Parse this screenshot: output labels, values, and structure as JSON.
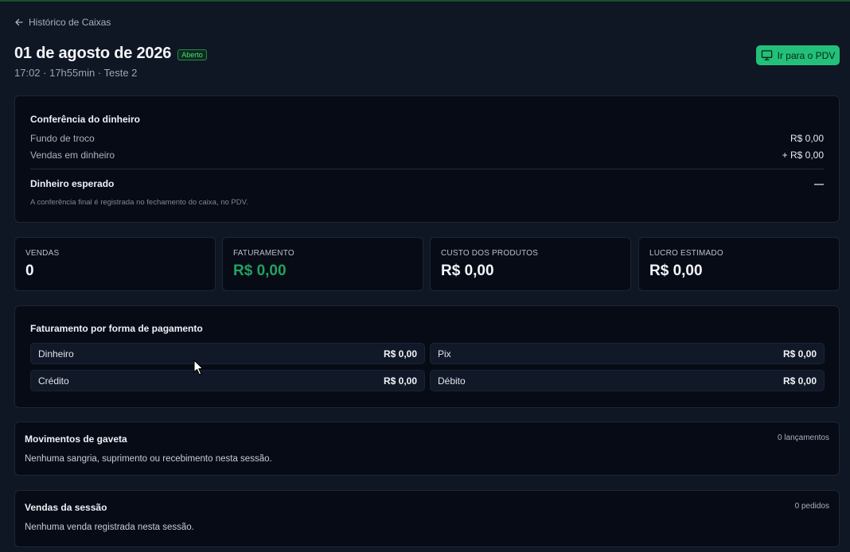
{
  "nav": {
    "back_label": "Histórico de Caixas"
  },
  "header": {
    "title": "01 de agosto de 2026",
    "status_badge": "Aberto",
    "subtitle": "17:02 · 17h55min · Teste 2",
    "pdv_button_label": "Ir para o PDV"
  },
  "conferencia": {
    "title": "Conferência do dinheiro",
    "rows": [
      {
        "label": "Fundo de troco",
        "value": "R$ 0,00"
      },
      {
        "label": "Vendas em dinheiro",
        "value": "+ R$ 0,00"
      }
    ],
    "expected_label": "Dinheiro esperado",
    "expected_value": "—",
    "note": "A conferência final é registrada no fechamento do caixa, no PDV."
  },
  "stats": [
    {
      "label": "VENDAS",
      "value": "0"
    },
    {
      "label": "FATURAMENTO",
      "value": "R$ 0,00"
    },
    {
      "label": "CUSTO DOS PRODUTOS",
      "value": "R$ 0,00"
    },
    {
      "label": "LUCRO ESTIMADO",
      "value": "R$ 0,00"
    }
  ],
  "payments": {
    "title": "Faturamento por forma de pagamento",
    "items": [
      {
        "label": "Dinheiro",
        "value": "R$ 0,00"
      },
      {
        "label": "Pix",
        "value": "R$ 0,00"
      },
      {
        "label": "Crédito",
        "value": "R$ 0,00"
      },
      {
        "label": "Débito",
        "value": "R$ 0,00"
      }
    ]
  },
  "movimentos": {
    "title": "Movimentos de gaveta",
    "count": "0 lançamentos",
    "empty_text": "Nenhuma sangria, suprimento ou recebimento nesta sessão."
  },
  "vendas": {
    "title": "Vendas da sessão",
    "count": "0 pedidos",
    "empty_text": "Nenhuma venda registrada nesta sessão."
  },
  "colors": {
    "background": "#0f1624",
    "card": "#070b16",
    "accent_green": "#22c07a",
    "revenue_green": "#22a35f"
  },
  "icons": {
    "back": "arrow-left-icon",
    "pdv": "monitor-icon",
    "cursor": "mouse-pointer-icon"
  }
}
